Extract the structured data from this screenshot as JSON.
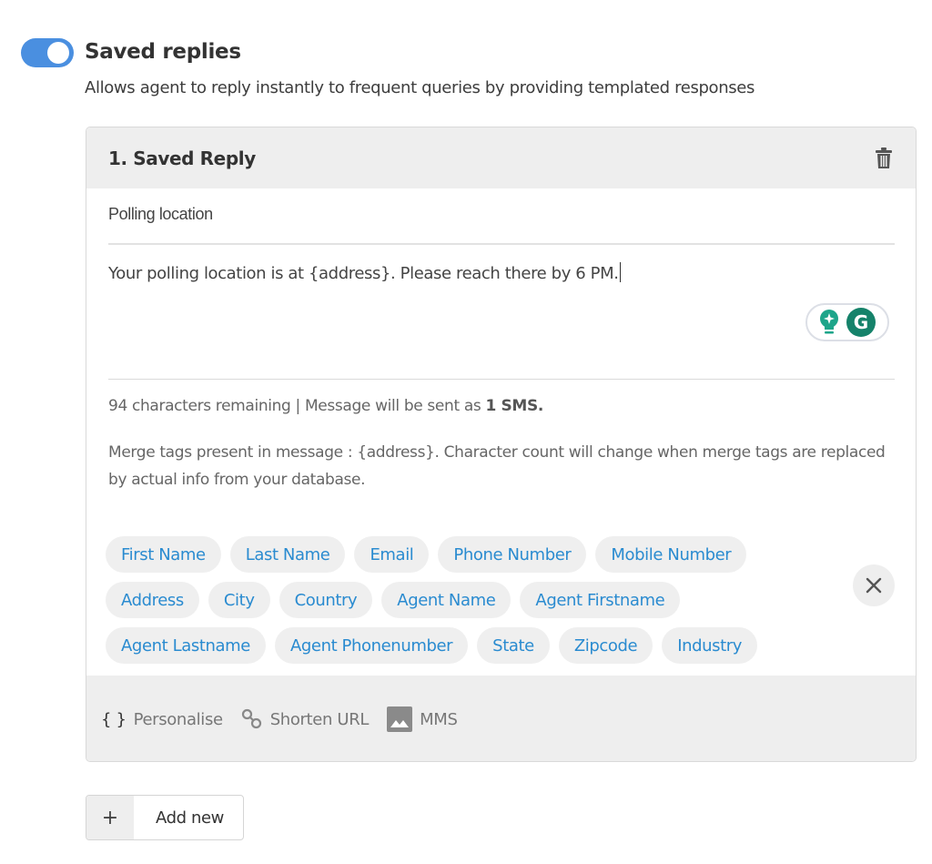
{
  "section": {
    "toggle_on": true,
    "title": "Saved replies",
    "description": "Allows agent to reply instantly to frequent queries by providing templated responses"
  },
  "card": {
    "title": "1. Saved Reply",
    "subject_value": "Polling location",
    "message_value": "Your polling location is at {address}. Please reach there by 6 PM.",
    "count_text": "94 characters remaining | Message will be sent as ",
    "count_bold": "1 SMS.",
    "merge_note": "Merge tags present in message : {address}. Character count will change when merge tags are replaced by actual info from your database.",
    "tags": [
      "First Name",
      "Last Name",
      "Email",
      "Phone Number",
      "Mobile Number",
      "Address",
      "City",
      "Country",
      "Agent Name",
      "Agent Firstname",
      "Agent Lastname",
      "Agent Phonenumber",
      "State",
      "Zipcode",
      "Industry"
    ],
    "toolbar": {
      "personalise_icon": "{ }",
      "personalise": "Personalise",
      "shorten_url": "Shorten URL",
      "mms": "MMS"
    }
  },
  "add_new": {
    "icon": "+",
    "label": "Add new"
  },
  "colors": {
    "toggle": "#4a8fe0",
    "tag_text": "#2a8bd0",
    "grammarly": "#15826a"
  }
}
